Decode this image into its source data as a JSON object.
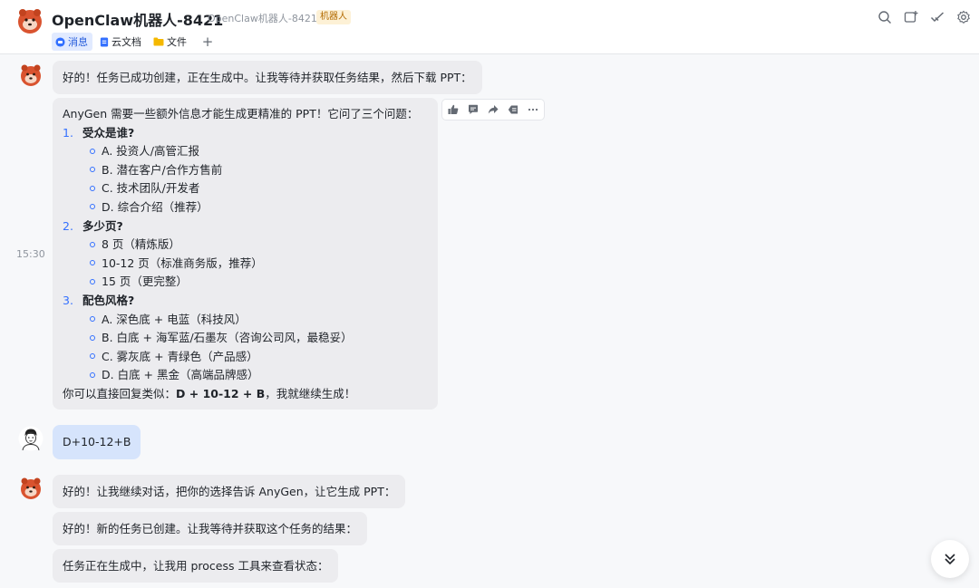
{
  "header": {
    "title": "OpenClaw机器人-8421",
    "subtitle": "OpenClaw机器人-8421",
    "badge": "机器人",
    "icons": [
      "search-icon",
      "add-chat-icon",
      "check-icon",
      "settings-icon"
    ]
  },
  "tabs": [
    {
      "label": "消息",
      "icon": "message-icon",
      "active": true
    },
    {
      "label": "云文档",
      "icon": "doc-icon",
      "active": false
    },
    {
      "label": "文件",
      "icon": "folder-icon",
      "active": false
    }
  ],
  "messages": {
    "m1": "好的！任务已成功创建，正在生成中。让我等待并获取任务结果，然后下载 PPT：",
    "timestamp": "15:30",
    "long": {
      "intro": "AnyGen 需要一些额外信息才能生成更精准的 PPT！它问了三个问题：",
      "questions": [
        {
          "num": "1.",
          "title": "受众是谁?",
          "options": [
            "A. 投资人/高管汇报",
            "B. 潜在客户/合作方售前",
            "C. 技术团队/开发者",
            "D. 综合介绍（推荐）"
          ]
        },
        {
          "num": "2.",
          "title": "多少页?",
          "options": [
            "8 页（精炼版）",
            "10-12 页（标准商务版，推荐）",
            "15 页（更完整）"
          ]
        },
        {
          "num": "3.",
          "title": "配色风格?",
          "options": [
            "A. 深色底 + 电蓝（科技风）",
            "B. 白底 + 海军蓝/石墨灰（咨询公司风，最稳妥）",
            "C. 雾灰底 + 青绿色（产品感）",
            "D. 白底 + 黑金（高端品牌感）"
          ]
        }
      ],
      "outro_prefix": "你可以直接回复类似：",
      "outro_bold": "D + 10-12 + B",
      "outro_suffix": "，我就继续生成！"
    },
    "user_reply": "D+10-12+B",
    "m3": "好的！让我继续对话，把你的选择告诉 AnyGen，让它生成 PPT：",
    "m4": "好的！新的任务已创建。让我等待并获取这个任务的结果：",
    "m5": "任务正在生成中，让我用 process 工具来查看状态："
  },
  "actions": [
    "thumbs-up-icon",
    "comment-icon",
    "forward-icon",
    "tag-icon",
    "more-icon"
  ],
  "colors": {
    "accent": "#3370ff",
    "bot_bubble": "#ececef",
    "user_bubble": "#d6e4fc"
  }
}
